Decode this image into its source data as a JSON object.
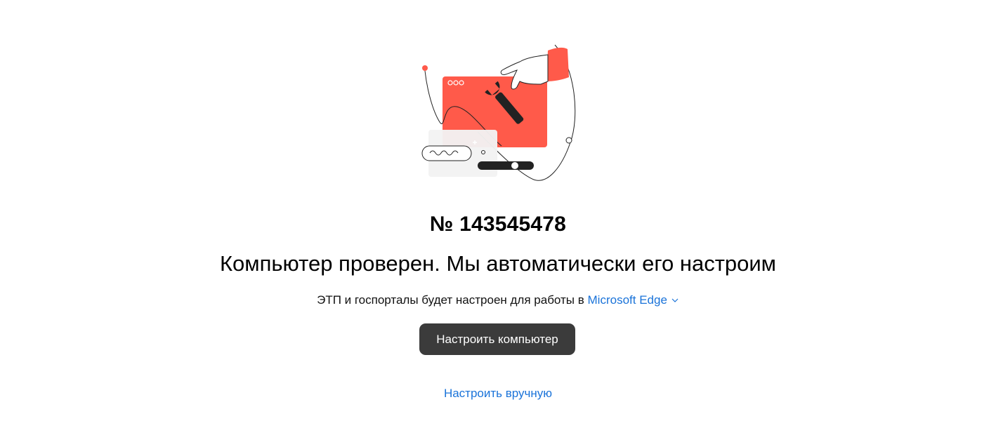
{
  "ticket": {
    "number": "№ 143545478"
  },
  "headline": "Компьютер проверен. Мы автоматически его настроим",
  "setup_info": {
    "prefix": "ЭТП и госпорталы будет настроен для работы в",
    "browser": "Microsoft Edge"
  },
  "actions": {
    "primary": "Настроить компьютер",
    "manual": "Настроить вручную"
  },
  "icons": {
    "illustration": "computer-repair-illustration",
    "browser_dropdown": "chevron-down-icon"
  },
  "colors": {
    "accent": "#ff5a4a",
    "link": "#1a73d9",
    "button": "#3b3b3b"
  }
}
